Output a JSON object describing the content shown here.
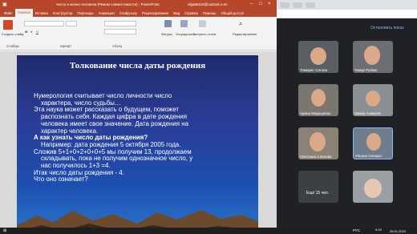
{
  "ppt": {
    "document_title": "число в жизни человека (Режим совместимости) - PowerPoint",
    "user_email": "olga66118@outlook.com",
    "tabs": [
      "Файл",
      "Главная",
      "Вставка",
      "Конструктор",
      "Переходы",
      "Анимация",
      "Слайд-шоу",
      "Рецензирование",
      "Вид",
      "Справка",
      "Помощь",
      "Общий доступ"
    ],
    "active_tab": "Главная",
    "ribbon": {
      "slides_label": "Создать слайд",
      "group_slides": "Слайды",
      "group_font": "Шрифт",
      "group_paragraph": "Абзац",
      "figures": "Фигуры",
      "arrange": "Упорядочить",
      "styles": "Экспресс-стили",
      "edit": "Редактирование"
    }
  },
  "slide": {
    "title": "Толкование числа даты рождения",
    "lines": [
      {
        "text": "Нумерология считывает число личности число",
        "indent": false,
        "bold": false
      },
      {
        "text": "характера, число судьбы…",
        "indent": true,
        "bold": false
      },
      {
        "text": "Эта наука может рассказать о будущем, поможет",
        "indent": false,
        "bold": false
      },
      {
        "text": "распознать себя. Каждая цифра в дате рождения",
        "indent": true,
        "bold": false
      },
      {
        "text": "человека имеет свое значение. Дата рождения на",
        "indent": true,
        "bold": false
      },
      {
        "text": "характер человека.",
        "indent": true,
        "bold": false
      },
      {
        "text": "А как узнать число даты рождения?",
        "indent": false,
        "bold": true
      },
      {
        "text": "Например: дата  рождения 5 октября 2005 года.",
        "indent": true,
        "bold": false
      },
      {
        "text": "Сложив 5+1+0+2+0+0+5 мы получим 13, продолжаем",
        "indent": false,
        "bold": false
      },
      {
        "text": "складывать, пока не получим однозначное число, у",
        "indent": true,
        "bold": false
      },
      {
        "text": "нас получилось 1+3 =4.",
        "indent": true,
        "bold": false
      },
      {
        "text": "Итак  число даты рождения - 4.",
        "indent": false,
        "bold": false
      },
      {
        "text": "Что оно означает?",
        "indent": false,
        "bold": false
      }
    ]
  },
  "meet": {
    "stop_label": "Остановить показ",
    "participants": [
      "Томирис Сатова",
      "Тимур Рыбин",
      "Арина Марущенко",
      "Замир Ахмеров",
      "Светлана Слепова",
      "Ульяна Олешко"
    ],
    "more_label": "Ещё 15 чел."
  },
  "taskbar": {
    "time": "9:23",
    "date": "28.01.2022",
    "lang": "РУС"
  }
}
